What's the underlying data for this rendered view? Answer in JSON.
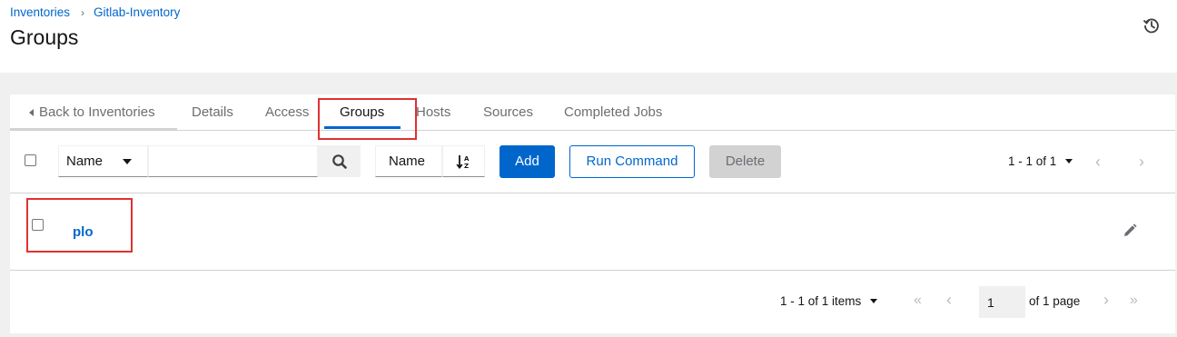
{
  "breadcrumb": {
    "root": "Inventories",
    "separator": "›",
    "current": "Gitlab-Inventory"
  },
  "page": {
    "title": "Groups"
  },
  "tabs": {
    "back": "Back to Inventories",
    "details": "Details",
    "access": "Access",
    "groups": "Groups",
    "hosts": "Hosts",
    "sources": "Sources",
    "completed_jobs": "Completed Jobs"
  },
  "toolbar": {
    "filter_field": "Name",
    "search_value": "",
    "sort_field": "Name",
    "add_label": "Add",
    "run_command_label": "Run Command",
    "delete_label": "Delete",
    "pagination_summary": "1 - 1 of 1"
  },
  "rows": [
    {
      "name": "plo"
    }
  ],
  "footer": {
    "items_summary": "1 - 1 of 1 items",
    "page_value": "1",
    "of_pages": "of 1 page"
  },
  "icons": {
    "history": "history-icon",
    "search": "search-icon",
    "sort": "sort-alpha-icon",
    "edit": "pencil-icon"
  },
  "colors": {
    "accent": "#0066cc",
    "highlight": "#e03131",
    "disabled": "#d2d2d2"
  }
}
